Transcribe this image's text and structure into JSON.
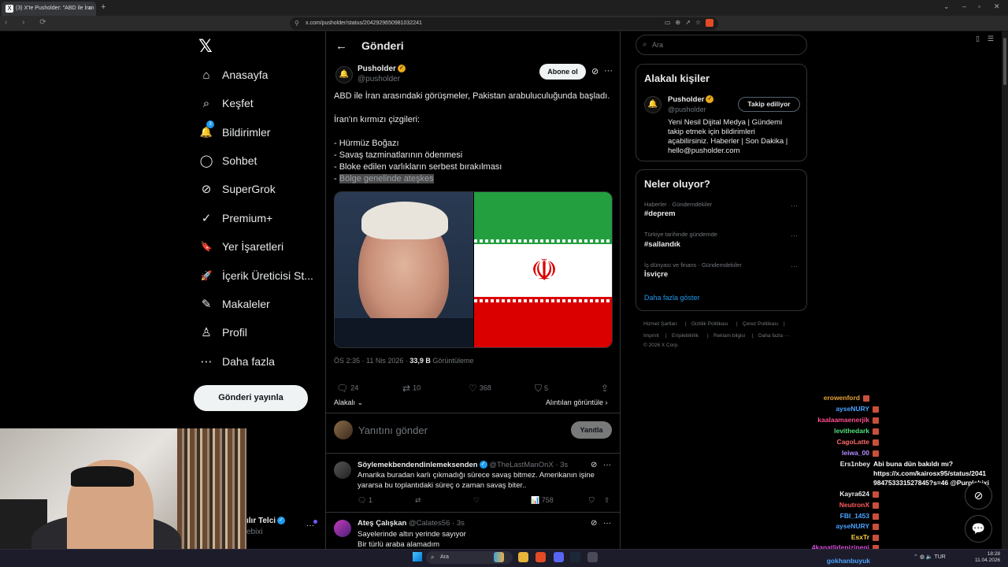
{
  "browser": {
    "tab_title": "(3) X'te Pusholder: \"ABD ile İran",
    "tab_favicon": "x-favicon",
    "tab_close": "×",
    "new_tab": "+",
    "url": "x.com/pusholder/status/2042929650981032241",
    "nav_glyphs": "‹ › ⟳"
  },
  "sidebar": {
    "logo": "𝕏",
    "items": [
      {
        "label": "Anasayfa",
        "icon": "⌂"
      },
      {
        "label": "Keşfet",
        "icon": "⌕"
      },
      {
        "label": "Bildirimler",
        "icon": "🔔",
        "badge": "3"
      },
      {
        "label": "Sohbet",
        "icon": "◯"
      },
      {
        "label": "SuperGrok",
        "icon": "⊘"
      },
      {
        "label": "Premium+",
        "icon": "✓"
      },
      {
        "label": "Yer İşaretleri",
        "icon": "🔖"
      },
      {
        "label": "İçerik Üreticisi St...",
        "icon": "🚀"
      },
      {
        "label": "Makaleler",
        "icon": "✎"
      },
      {
        "label": "Profil",
        "icon": "♙"
      },
      {
        "label": "Daha fazla",
        "icon": "⋯"
      }
    ],
    "post_button": "Gönderi yayınla",
    "account_name": "ılır Telci",
    "account_handle": "ebixi"
  },
  "main": {
    "header_title": "Gönderi",
    "tweet": {
      "name": "Pusholder",
      "handle": "@pusholder",
      "subscribe": "Abone ol",
      "lines": [
        "ABD ile İran arasındaki görüşmeler, Pakistan arabuluculuğunda başladı.",
        "İran'ın kırmızı çizgileri:",
        "- Hürmüz Boğazı",
        "- Savaş tazminatlarının ödenmesi",
        "- Bloke edilen varlıkların serbest bırakılması"
      ],
      "last_prefix": "- ",
      "last_highlight": "Bölge genelinde ateşkes",
      "time": "ÖS 2:35 · 11 Nis 2026 · ",
      "views": "33,9 B",
      "views_label": " Görüntüleme",
      "replies": "24",
      "reposts": "10",
      "likes": "368",
      "bookmarks": "5",
      "sort": "Alakalı ⌄",
      "quotes": "Alıntıları görüntüle ›"
    },
    "reply_placeholder": "Yanıtını gönder",
    "reply_button": "Yanıtla",
    "replies": [
      {
        "name": "Söylemekbendendinlemeksenden",
        "handle": "@TheLastManOnX · 3s",
        "lines": [
          "Amarika buradan karlı çıkmadığı sürece savaş bitmez. Amerikanın işine",
          "yararsa bu toplantıdaki süreç o zaman savaş biter.."
        ],
        "replies": "1",
        "views": "758"
      },
      {
        "name": "Ateş Çalışkan",
        "handle": "@Calates56 · 3s",
        "lines": [
          "Sayelerinde altın yerinde sayıyor",
          "Bir türlü araba alamadım"
        ]
      }
    ]
  },
  "right": {
    "search_placeholder": "Ara",
    "relevant_title": "Alakalı kişiler",
    "person": {
      "name": "Pusholder",
      "handle": "@pusholder",
      "follow": "Takip ediliyor",
      "bio": [
        "Yeni Nesil Dijital Medya | Gündemi",
        "takip etmek için bildirimleri",
        "açabilirsiniz. Haberler | Son Dakika |",
        "hello@pusholder.com"
      ]
    },
    "trends_title": "Neler oluyor?",
    "trends": [
      {
        "category": "Haberler · Gündemdekiler",
        "tag": "#deprem"
      },
      {
        "category": "Türkiye tarihinde gündemde",
        "tag": "#sallandık"
      },
      {
        "category": "İş dünyası ve finans · Gündemdekiler",
        "tag": "İsviçre"
      }
    ],
    "show_more": "Daha fazla göster",
    "footer": [
      "Hizmet Şartları",
      "|",
      "Gizlilik Politikası",
      "|",
      "Çerez Politikası",
      "|",
      "Imprint",
      "|",
      "Erişilebilirlik",
      "|",
      "Reklam bilgisi",
      "|",
      "Daha fazla ···",
      "© 2026 X Corp."
    ]
  },
  "chat": {
    "users": [
      {
        "name": "erowenford",
        "color": "#e8a23b"
      },
      {
        "name": "ayseNURY",
        "color": "#4aa3ff"
      },
      {
        "name": "kaalaamaenerjik",
        "color": "#ff4d8f"
      },
      {
        "name": "levithedark",
        "color": "#52e07a"
      },
      {
        "name": "CagoLatte",
        "color": "#ff6b6b"
      },
      {
        "name": "leiwa_00",
        "color": "#b68cff"
      },
      {
        "name": "Ers1nbey",
        "color": "#e7e9ea"
      },
      {
        "name": "Kayra624",
        "color": "#e7e9ea"
      },
      {
        "name": "NeutronX",
        "color": "#ff5a5a"
      },
      {
        "name": "FBI_1453",
        "color": "#4aa3ff"
      },
      {
        "name": "ayseNURY",
        "color": "#4aa3ff"
      },
      {
        "name": "EsxTr",
        "color": "#ffd24a"
      },
      {
        "name": "4kanatlidenizinegi",
        "color": "#d94ed9"
      },
      {
        "name": "gokhanbuyuk",
        "color": "#4aa3ff"
      }
    ],
    "message_lines": [
      "Abi buna dün bakıldı mı?",
      "https://x.com/kairosx95/status/2041",
      "984753331527845?s=46 @Purplebixi"
    ]
  },
  "taskbar": {
    "search": "Ara",
    "lang": "TUR",
    "time": "18:28",
    "date": "11.04.2026"
  }
}
